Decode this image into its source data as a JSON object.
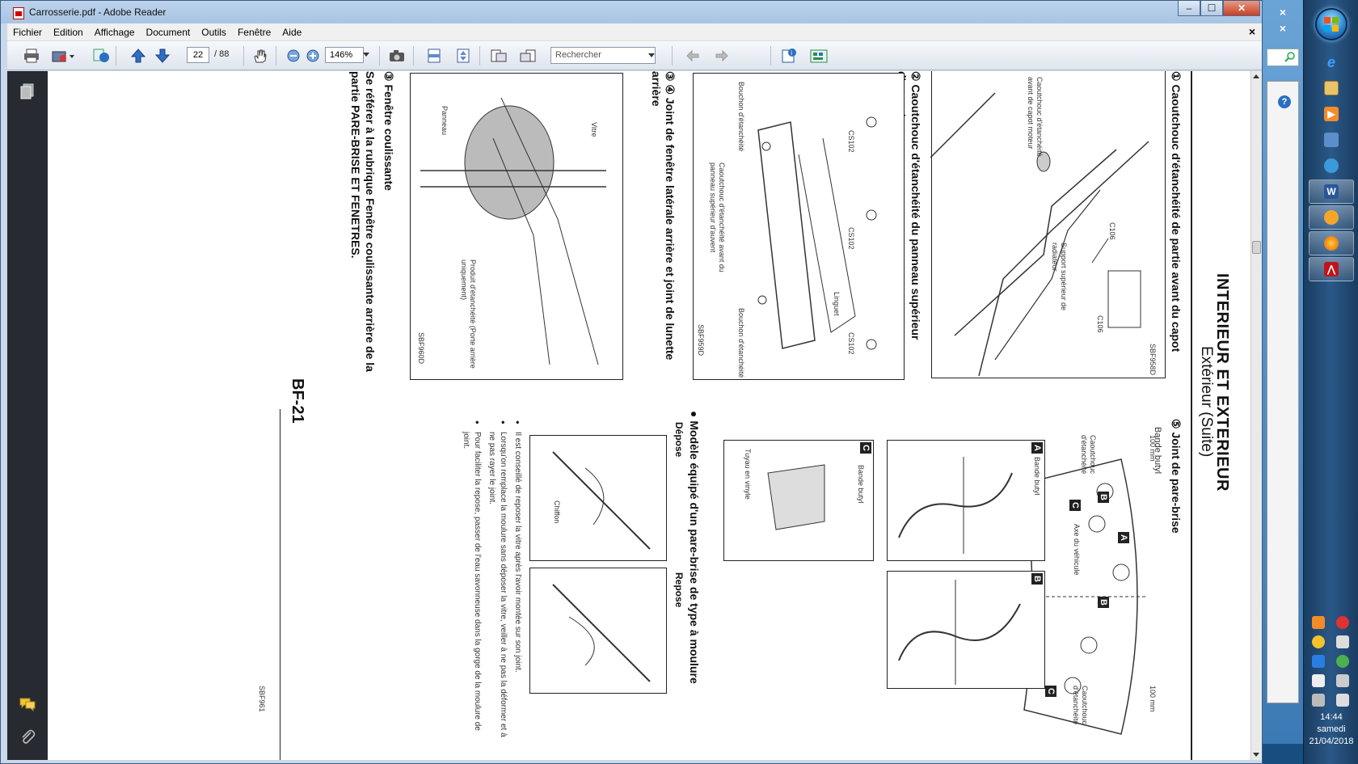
{
  "window": {
    "title": "Carrosserie.pdf - Adobe Reader",
    "controls": {
      "minimize": "–",
      "maximize": "☐",
      "close": "✕"
    }
  },
  "menubar": {
    "items": [
      "Fichier",
      "Edition",
      "Affichage",
      "Document",
      "Outils",
      "Fenêtre",
      "Aide"
    ],
    "close": "×"
  },
  "toolbar": {
    "page_current": "22",
    "page_total": "/ 88",
    "zoom": "146%",
    "search_placeholder": "Rechercher"
  },
  "background_window": {
    "close": "×",
    "close2": "×",
    "help": "?"
  },
  "document": {
    "section_title": "INTERIEUR ET EXTERIEUR",
    "subtitle": "Extérieur (Suite)",
    "heading1": "① Caoutchouc d'étanchéité de partie avant du capot",
    "heading2": "② Caoutchouc d'étanchéité du panneau supérieur d'auvent",
    "heading3": "③ ④ Joint de fenêtre latérale arrière et joint de lunette arrière",
    "heading4_title": "③ Fenêtre coulissante",
    "heading4_body": "Se référer à la rubrique Fenêtre coulissante arrière de la partie PARE-BRISE ET FENETRES.",
    "heading5": "⑤ Joint de pare-brise",
    "heading6": "● Modèle équipé d'un pare-brise de type à moulure",
    "page_number": "BF-21",
    "fig1": {
      "code": "SBF958D",
      "label_a": "Caoutchouc d'étanchéité avant de capot moteur",
      "label_b": "Support supérieur de radiateur",
      "c1": "C106",
      "c2": "C106"
    },
    "fig2": {
      "code": "SBF959D",
      "label_a": "Bouchon d'étanchéité",
      "label_b": "Caoutchouc d'étanchéité avant du panneau supérieur d'auvent",
      "label_c": "Linguet",
      "label_d": "Bouchon d'étanchéité",
      "c1": "CS102",
      "c2": "CS102",
      "c3": "CS102"
    },
    "fig3": {
      "code": "SBF960D",
      "label_a": "Vitre",
      "label_b": "Panneau",
      "label_c": "Produit d'étanchéité (Porte arrière uniquement)"
    },
    "fig4": {
      "bande": "Bande butyl",
      "mm1": "100 mm",
      "mm2": "100 mm",
      "caout1": "Caoutchouc d'étanchéité",
      "caout2": "Caoutchouc d'étanchéité",
      "axe": "Axe du véhicule",
      "A": "A",
      "B1": "B",
      "B2": "B",
      "C1": "C",
      "C2": "C"
    },
    "figA": {
      "letter": "A",
      "label": "Bande butyl"
    },
    "figB": {
      "letter": "B"
    },
    "figC": {
      "letter": "C",
      "label1": "Bande butyl",
      "label2": "Tuyau en vinyle"
    },
    "depose": "Dépose",
    "repose": "Repose",
    "chiffon": "Chiffon",
    "fig5_code": "SBF961",
    "bullets": [
      "Il est conseillé de reposer la vitre après l'avoir montée sur son joint.",
      "Lorsqu'on remplace la moulure sans déposer la vitre, veiller à ne pas la déformer et à ne pas rayer le joint.",
      "Pour faciliter la repose, passer de l'eau savonneuse dans la gorge de la moulure de joint."
    ]
  },
  "taskbar": {
    "time": "14:44",
    "day": "samedi",
    "date": "21/04/2018"
  },
  "colors": {
    "accent": "#2a6fc1",
    "adobe_red": "#c0141a",
    "nav_dark": "#272a30"
  }
}
